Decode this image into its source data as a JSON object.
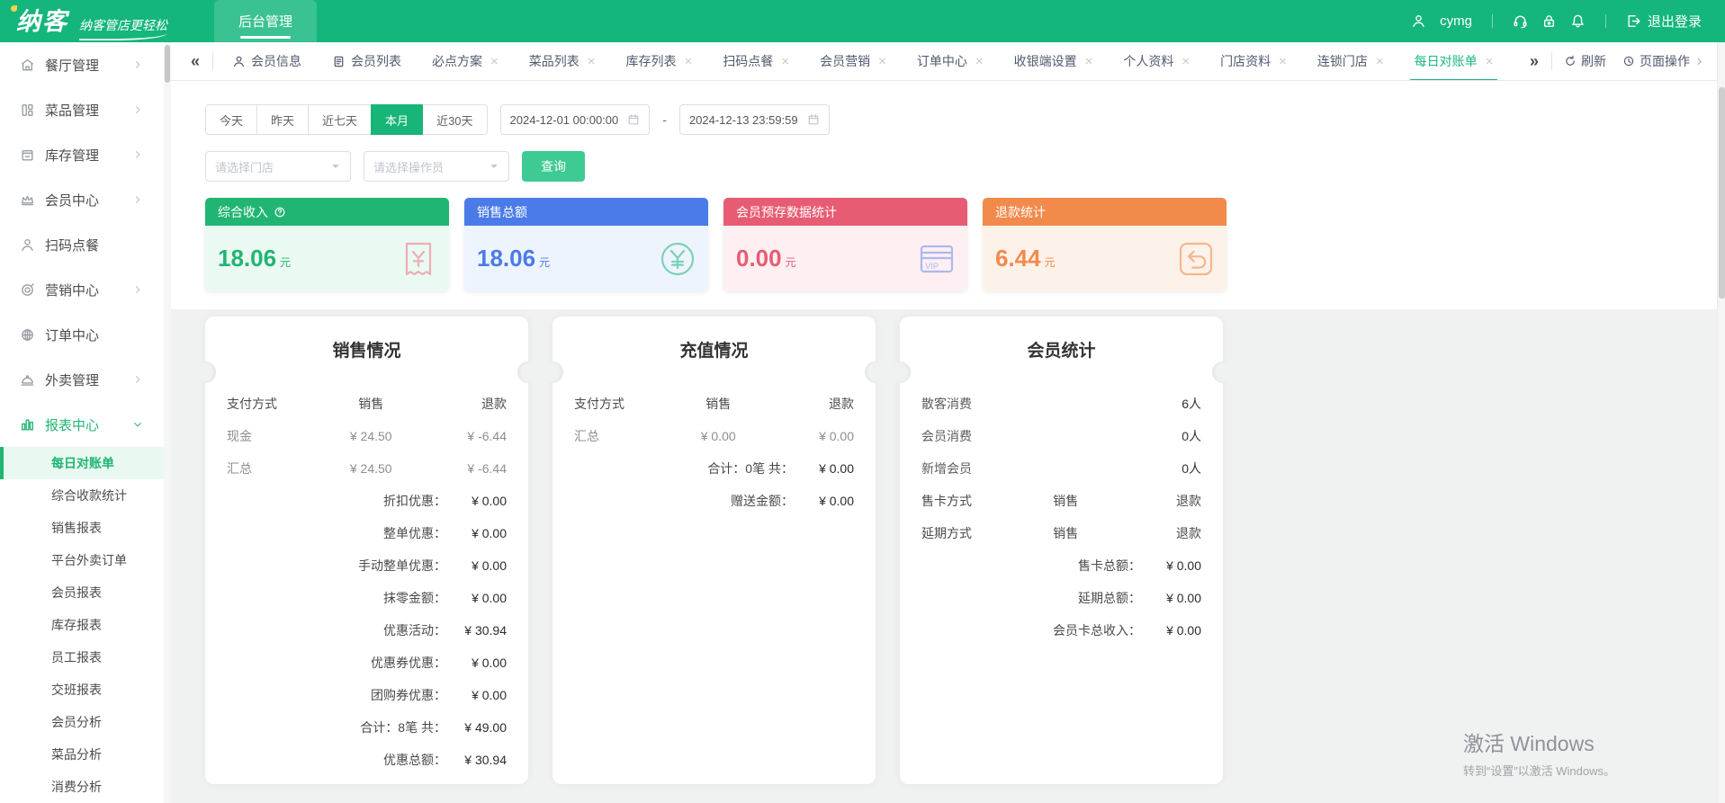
{
  "header": {
    "logo": "纳客",
    "tagline": "纳客管店更轻松",
    "nav_tab": "后台管理",
    "username": "cymg",
    "logout": "退出登录"
  },
  "tabbar": {
    "collapse_glyph": "«",
    "expand_glyph": "»",
    "refresh": "刷新",
    "page_ops": "页面操作",
    "tabs": [
      {
        "label": "会员信息",
        "icon": "person",
        "close": false,
        "active": false
      },
      {
        "label": "会员列表",
        "icon": "doc",
        "close": false,
        "active": false
      },
      {
        "label": "必点方案",
        "close": true,
        "active": false
      },
      {
        "label": "菜品列表",
        "close": true,
        "active": false
      },
      {
        "label": "库存列表",
        "close": true,
        "active": false
      },
      {
        "label": "扫码点餐",
        "close": true,
        "active": false
      },
      {
        "label": "会员营销",
        "close": true,
        "active": false
      },
      {
        "label": "订单中心",
        "close": true,
        "active": false
      },
      {
        "label": "收银端设置",
        "close": true,
        "active": false
      },
      {
        "label": "个人资料",
        "close": true,
        "active": false
      },
      {
        "label": "门店资料",
        "close": true,
        "active": false
      },
      {
        "label": "连锁门店",
        "close": true,
        "active": false
      },
      {
        "label": "每日对账单",
        "close": true,
        "active": true
      }
    ]
  },
  "sidebar": {
    "items": [
      {
        "label": "餐厅管理",
        "icon": "restaurant",
        "arrow": "right"
      },
      {
        "label": "菜品管理",
        "icon": "dishes",
        "arrow": "right"
      },
      {
        "label": "库存管理",
        "icon": "inventory",
        "arrow": "right"
      },
      {
        "label": "会员中心",
        "icon": "member",
        "arrow": "right"
      },
      {
        "label": "扫码点餐",
        "icon": "scan",
        "arrow": "none"
      },
      {
        "label": "营销中心",
        "icon": "marketing",
        "arrow": "right"
      },
      {
        "label": "订单中心",
        "icon": "order",
        "arrow": "none"
      },
      {
        "label": "外卖管理",
        "icon": "takeout",
        "arrow": "right"
      },
      {
        "label": "报表中心",
        "icon": "report",
        "arrow": "down",
        "active": true,
        "children": [
          {
            "label": "每日对账单",
            "active": true
          },
          {
            "label": "综合收款统计",
            "active": false
          },
          {
            "label": "销售报表",
            "active": false
          },
          {
            "label": "平台外卖订单",
            "active": false
          },
          {
            "label": "会员报表",
            "active": false
          },
          {
            "label": "库存报表",
            "active": false
          },
          {
            "label": "员工报表",
            "active": false
          },
          {
            "label": "交班报表",
            "active": false
          },
          {
            "label": "会员分析",
            "active": false
          },
          {
            "label": "菜品分析",
            "active": false
          },
          {
            "label": "消费分析",
            "active": false
          }
        ]
      }
    ]
  },
  "filters": {
    "quick_ranges": [
      "今天",
      "昨天",
      "近七天",
      "本月",
      "近30天"
    ],
    "active_range": "本月",
    "date_from": "2024-12-01 00:00:00",
    "date_to": "2024-12-13 23:59:59",
    "range_separator": "-",
    "store_placeholder": "请选择门店",
    "operator_placeholder": "请选择操作员",
    "search_label": "查询"
  },
  "stat_cards": [
    {
      "title": "综合收入",
      "has_help": true,
      "value": "18.06",
      "unit": "元",
      "icon": "receipt-yen",
      "header_color": "#21b573",
      "body_color": "#eafaf2",
      "value_color": "#21b573",
      "icon_color": "#ef9aa6"
    },
    {
      "title": "销售总额",
      "has_help": false,
      "value": "18.06",
      "unit": "元",
      "icon": "yen-circle",
      "header_color": "#4a7be8",
      "body_color": "#eef4fe",
      "value_color": "#4a7be8",
      "icon_color": "#5fcaa1"
    },
    {
      "title": "会员预存数据统计",
      "has_help": false,
      "value": "0.00",
      "unit": "元",
      "icon": "vip-card",
      "header_color": "#e85c73",
      "body_color": "#fdeff2",
      "value_color": "#e85c73",
      "icon_color": "#9aabec"
    },
    {
      "title": "退款统计",
      "has_help": false,
      "value": "6.44",
      "unit": "元",
      "icon": "refund",
      "header_color": "#f28a4b",
      "body_color": "#fdf2e9",
      "value_color": "#f28a4b",
      "icon_color": "#f4a878"
    }
  ],
  "panels": [
    {
      "title": "销售情况",
      "rows": [
        {
          "kind": "head",
          "cells": [
            "支付方式",
            "销售",
            "退款"
          ]
        },
        {
          "kind": "data",
          "cells": [
            "现金",
            "¥ 24.50",
            "¥ -6.44"
          ]
        },
        {
          "kind": "data",
          "cells": [
            "汇总",
            "¥ 24.50",
            "¥ -6.44"
          ]
        }
      ],
      "summary": [
        {
          "label": "折扣优惠：",
          "value": "¥ 0.00"
        },
        {
          "label": "整单优惠：",
          "value": "¥ 0.00"
        },
        {
          "label": "手动整单优惠：",
          "value": "¥ 0.00"
        },
        {
          "label": "抹零金额：",
          "value": "¥ 0.00"
        },
        {
          "label": "优惠活动：",
          "value": "¥ 30.94"
        },
        {
          "label": "优惠券优惠：",
          "value": "¥ 0.00"
        },
        {
          "label": "团购券优惠：",
          "value": "¥ 0.00"
        },
        {
          "label": "合计：8笔 共：",
          "value": "¥ 49.00"
        },
        {
          "label": "优惠总额：",
          "value": "¥ 30.94"
        }
      ]
    },
    {
      "title": "充值情况",
      "rows": [
        {
          "kind": "head",
          "cells": [
            "支付方式",
            "销售",
            "退款"
          ]
        },
        {
          "kind": "data",
          "cells": [
            "汇总",
            "¥ 0.00",
            "¥ 0.00"
          ]
        }
      ],
      "summary": [
        {
          "label": "合计：0笔 共：",
          "value": "¥ 0.00"
        },
        {
          "label": "赠送金额：",
          "value": "¥ 0.00"
        }
      ]
    },
    {
      "title": "会员统计",
      "rows": [
        {
          "kind": "kv",
          "cells": [
            "散客消费",
            "",
            "6人"
          ]
        },
        {
          "kind": "kv",
          "cells": [
            "会员消费",
            "",
            "0人"
          ]
        },
        {
          "kind": "kv",
          "cells": [
            "新增会员",
            "",
            "0人"
          ]
        },
        {
          "kind": "head",
          "cells": [
            "售卡方式",
            "销售",
            "退款"
          ]
        },
        {
          "kind": "head",
          "cells": [
            "延期方式",
            "销售",
            "退款"
          ]
        }
      ],
      "summary": [
        {
          "label": "售卡总额：",
          "value": "¥ 0.00"
        },
        {
          "label": "延期总额：",
          "value": "¥ 0.00"
        },
        {
          "label": "会员卡总收入：",
          "value": "¥ 0.00"
        }
      ]
    }
  ],
  "watermark": {
    "line1": "激活 Windows",
    "line2": "转到“设置”以激活 Windows。"
  }
}
